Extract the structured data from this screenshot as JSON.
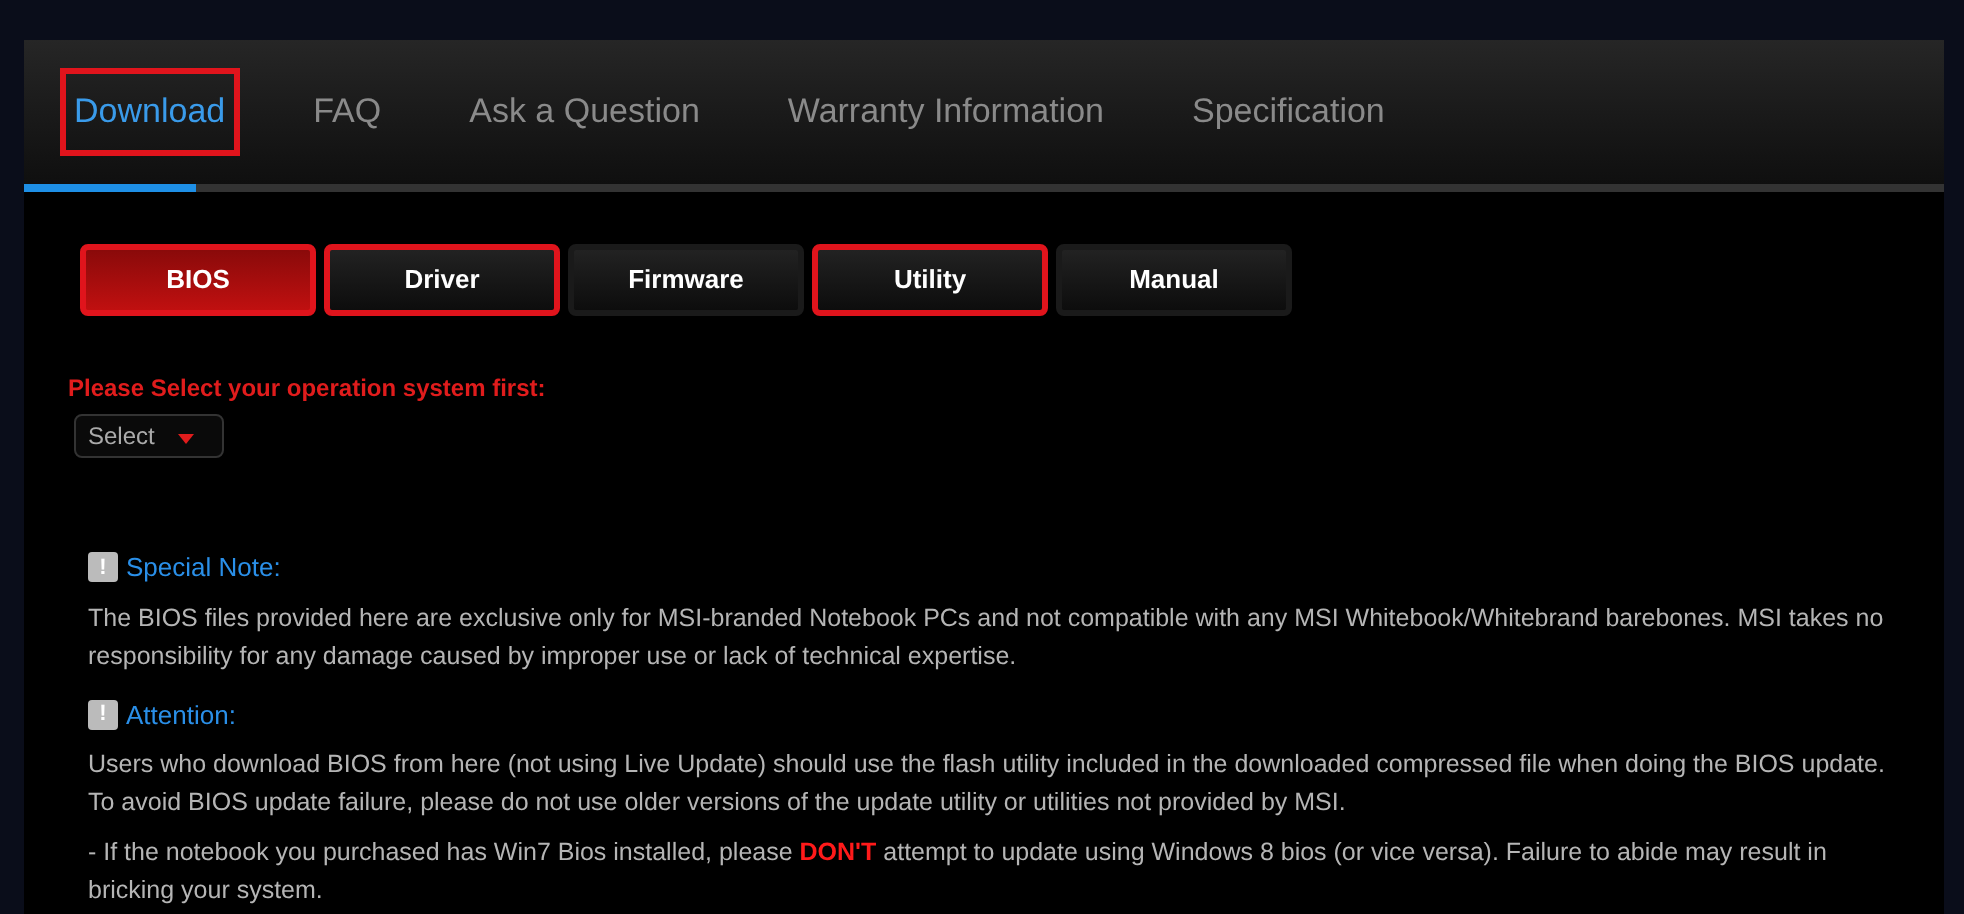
{
  "tabs": [
    {
      "label": "Download",
      "selected": true,
      "highlighted": true
    },
    {
      "label": "FAQ",
      "selected": false,
      "highlighted": false
    },
    {
      "label": "Ask a Question",
      "selected": false,
      "highlighted": false
    },
    {
      "label": "Warranty Information",
      "selected": false,
      "highlighted": false
    },
    {
      "label": "Specification",
      "selected": false,
      "highlighted": false
    }
  ],
  "categories": [
    {
      "label": "BIOS",
      "selected": true,
      "highlighted": true
    },
    {
      "label": "Driver",
      "selected": false,
      "highlighted": true
    },
    {
      "label": "Firmware",
      "selected": false,
      "highlighted": false
    },
    {
      "label": "Utility",
      "selected": false,
      "highlighted": true
    },
    {
      "label": "Manual",
      "selected": false,
      "highlighted": false
    }
  ],
  "os_prompt": "Please Select your operation system first:",
  "os_select": {
    "value": "Select"
  },
  "notes": [
    {
      "title": "Special Note:",
      "icon": "!",
      "paragraphs": [
        [
          {
            "kind": "plain",
            "text": "The BIOS files provided here are exclusive only for MSI-branded Notebook PCs and not compatible with any MSI Whitebook/Whitebrand barebones. MSI takes no responsibility for any damage caused by improper use or lack of technical expertise."
          }
        ]
      ]
    },
    {
      "title": "Attention:",
      "icon": "!",
      "paragraphs": [
        [
          {
            "kind": "plain",
            "text": "Users who download BIOS from here (not using Live Update) should use the flash utility included in the downloaded compressed file when doing the BIOS update. To avoid BIOS update failure, please do not use older versions of the update utility or utilities not provided by MSI."
          }
        ],
        [
          {
            "kind": "plain",
            "text": "- If the notebook you purchased has Win7 Bios installed, please "
          },
          {
            "kind": "warning",
            "text": "DON'T"
          },
          {
            "kind": "plain",
            "text": " attempt to update using Windows 8 bios (or vice versa). Failure to abide may result in bricking your system."
          }
        ]
      ]
    }
  ]
}
